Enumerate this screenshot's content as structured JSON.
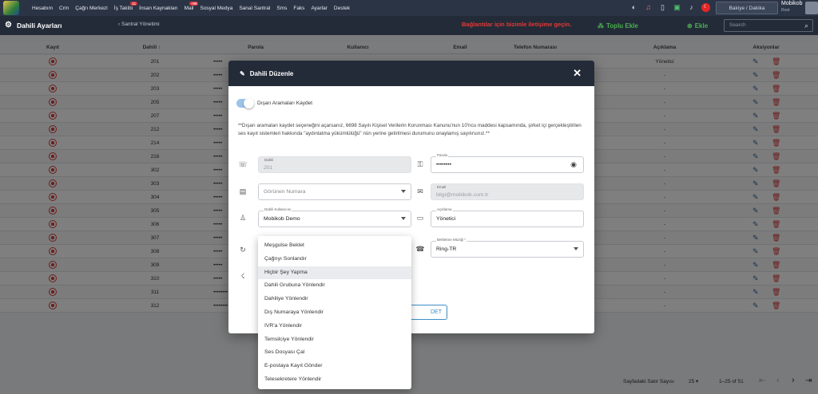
{
  "nav": {
    "items": [
      {
        "label": "Hesabım"
      },
      {
        "label": "Crm"
      },
      {
        "label": "Çağrı Merkezi"
      },
      {
        "label": "İş Takibi",
        "badge": "11"
      },
      {
        "label": "İnsan Kaynakları"
      },
      {
        "label": "Mail",
        "badge": "+99"
      },
      {
        "label": "Sosyal Medya"
      },
      {
        "label": "Sanal Santral"
      },
      {
        "label": "Sms"
      },
      {
        "label": "Faks"
      },
      {
        "label": "Ayarlar"
      },
      {
        "label": "Destek"
      }
    ],
    "balance_label": "Bakiye / Dakika",
    "user_name": "Mobikob",
    "user_role": "Root"
  },
  "header": {
    "title": "Dahili Ayarları",
    "breadcrumb": "Santral Yönetimi",
    "contact_text": "Bağlantılar için bizimle iletişime geçin.",
    "bulk_add_label": "Toplu Ekle",
    "add_label": "Ekle",
    "search_placeholder": "Search"
  },
  "table": {
    "columns": [
      "Kayıt",
      "Dahili",
      "Parola",
      "Kullanıcı",
      "Email",
      "Telefon Numarası",
      "Açıklama",
      "Aksiyonlar"
    ],
    "rows": [
      {
        "dahili": "201",
        "parola": "•••••",
        "aciklama": "Yönetici"
      },
      {
        "dahili": "202",
        "parola": "•••••",
        "aciklama": "-"
      },
      {
        "dahili": "203",
        "parola": "•••••",
        "aciklama": "-"
      },
      {
        "dahili": "205",
        "parola": "•••••",
        "aciklama": "-"
      },
      {
        "dahili": "207",
        "parola": "•••••",
        "aciklama": "-"
      },
      {
        "dahili": "212",
        "parola": "•••••",
        "aciklama": "-"
      },
      {
        "dahili": "214",
        "parola": "•••••",
        "aciklama": "-"
      },
      {
        "dahili": "216",
        "parola": "•••••",
        "aciklama": "-"
      },
      {
        "dahili": "302",
        "parola": "•••••",
        "aciklama": "-"
      },
      {
        "dahili": "303",
        "parola": "•••••",
        "aciklama": "-"
      },
      {
        "dahili": "304",
        "parola": "•••••",
        "aciklama": "-"
      },
      {
        "dahili": "305",
        "parola": "•••••",
        "aciklama": "-"
      },
      {
        "dahili": "306",
        "parola": "•••••",
        "aciklama": "-"
      },
      {
        "dahili": "307",
        "parola": "•••••",
        "aciklama": "-"
      },
      {
        "dahili": "308",
        "parola": "•••••",
        "aciklama": "-"
      },
      {
        "dahili": "309",
        "parola": "•••••",
        "aciklama": "-"
      },
      {
        "dahili": "310",
        "parola": "•••••",
        "aciklama": "-"
      },
      {
        "dahili": "311",
        "parola": "••••••••",
        "aciklama": "-"
      },
      {
        "dahili": "312",
        "parola": "••••••••",
        "aciklama": "-"
      }
    ]
  },
  "footer": {
    "rows_per_page_label": "Sayfadaki Satır Sayısı",
    "rows_per_page_value": "25",
    "range": "1–25 of 51"
  },
  "modal": {
    "title": "Dahili Düzenle",
    "toggle_label": "Dışarı Aramaları Kaydet",
    "notice": "**Dışarı aramaları kaydet seçeneğini açarsanız, 6698 Sayılı Kişisel Verilerin Korunması Kanunu'nun 10'ncu maddesi kapsamında, şirket içi gerçekleştirilen ses kayıt sistemleri hakkında \"aydınlatma yükümlülüğü\" nün yerine getirilmesi durumunu onaylamış sayılırsınız.**",
    "dahili_label": "Dahili",
    "dahili_value": "201",
    "parola_label": "Parola",
    "parola_value": "••••••••",
    "gorunen_placeholder": "Görünen Numara",
    "email_label": "Email",
    "email_value": "bilgi@mobikob.com.tr",
    "kullanici_label": "Dahili Kullanıcısı",
    "kullanici_value": "Mobikob Demo",
    "aciklama_label": "Açıklama",
    "aciklama_value": "Yönetici",
    "muzik_label": "Bekletme Müziği *",
    "muzik_value": "Ring-TR",
    "save_label": "DET"
  },
  "dropdown": {
    "options": [
      "Meşgulse Beklet",
      "Çağrıyı Sonlandır",
      "Hiçbir Şey Yapma",
      "Dahili Grubuna Yönlendir",
      "Dahiliye Yönlendir",
      "Dış Numaraya Yönlendir",
      "IVR'a Yönlendir",
      "Temsilciye Yönlendir",
      "Ses Dosyası Çal",
      "E-postaya Kayıt Gönder",
      "Telesekretere Yönlendir"
    ],
    "selected_index": 2
  }
}
